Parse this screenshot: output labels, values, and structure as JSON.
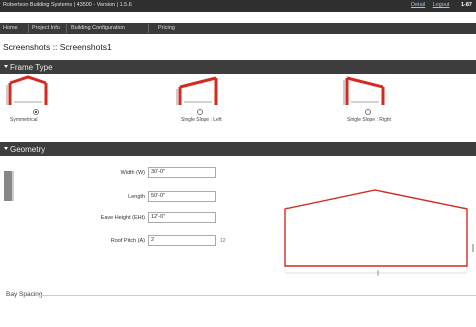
{
  "app": {
    "title": "Robertson Building Systems | 43500 - Version | 1.5.6",
    "links": [
      "Detail",
      "Logout"
    ],
    "phone": "1-87"
  },
  "nav": {
    "items": [
      "Home",
      "Project Info",
      "Building Configuration",
      "Pricing"
    ]
  },
  "breadcrumb": "Screenshots :: Screenshots1",
  "frame_type": {
    "title": "Frame Type",
    "options": [
      {
        "label": "Symmetrical",
        "selected": true
      },
      {
        "label": "Single Slope : Left",
        "selected": false
      },
      {
        "label": "Single Slope : Right",
        "selected": false
      }
    ],
    "accent": "#d42a1f"
  },
  "geometry": {
    "title": "Geometry",
    "fields": [
      {
        "label": "Width (W)",
        "value": "30'-0\""
      },
      {
        "label": "Length",
        "value": "50'-0\""
      },
      {
        "label": "Eave Height (EHt)",
        "value": "12'-0\""
      },
      {
        "label": "Roof Pitch (A)",
        "value": "2",
        "unit": "12"
      }
    ]
  },
  "bay_spacing": {
    "title": "Bay Spacing"
  }
}
